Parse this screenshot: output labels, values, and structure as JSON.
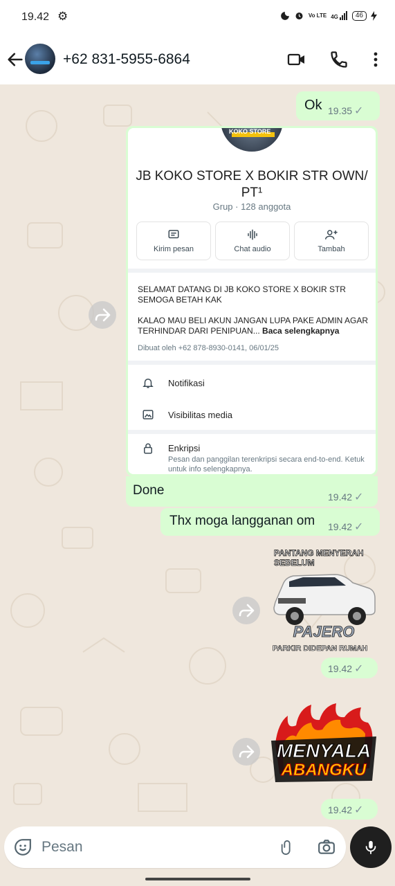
{
  "status_bar": {
    "time": "19.42",
    "network": "Vo LTE",
    "signal": "4G",
    "battery": "46"
  },
  "header": {
    "contact": "+62 831-5955-6864"
  },
  "messages": {
    "ok": {
      "text": "Ok",
      "time": "19.35"
    },
    "done": {
      "text": "Done",
      "time": "19.42"
    },
    "thanks": {
      "text": "Thx moga langganan om",
      "time": "19.42"
    },
    "sticker1": {
      "time": "19.42",
      "top_text_1": "PANTANG MENYERAH",
      "top_text_2": "SEBELUM",
      "brand_text": "PAJERO",
      "bottom_text": "PARKIR DIDEPAN RUMAH"
    },
    "sticker2": {
      "time": "19.42",
      "line1": "MENYALA",
      "line2": "ABANGKU"
    }
  },
  "group_card": {
    "picture_text": "KOKO STORE",
    "name": "JB KOKO STORE X BOKIR STR OWN/ PT¹",
    "meta": "Grup · 128 anggota",
    "buttons": [
      {
        "label": "Kirim pesan",
        "icon": "message-icon"
      },
      {
        "label": "Chat audio",
        "icon": "audio-wave-icon"
      },
      {
        "label": "Tambah",
        "icon": "add-person-icon"
      }
    ],
    "description_1": "SELAMAT DATANG DI JB KOKO STORE X BOKIR STR SEMOGA BETAH KAK",
    "description_2": "KALAO MAU BELI AKUN JANGAN LUPA PAKE ADMIN AGAR TERHINDAR DARI PENIPUAN...",
    "read_more": "Baca selengkapnya",
    "created": "Dibuat oleh +62 878-8930-0141, 06/01/25",
    "rows": [
      {
        "label": "Notifikasi",
        "icon": "bell-icon"
      },
      {
        "label": "Visibilitas media",
        "icon": "image-icon"
      },
      {
        "label": "Enkripsi",
        "icon": "lock-icon",
        "sub": "Pesan dan panggilan terenkripsi secara end-to-end. Ketuk untuk info selengkapnya."
      }
    ]
  },
  "input": {
    "placeholder": "Pesan"
  },
  "colors": {
    "outgoing_bubble": "#d9fdd3",
    "chat_bg": "#efe7dd",
    "header_bg": "#ffffff"
  }
}
